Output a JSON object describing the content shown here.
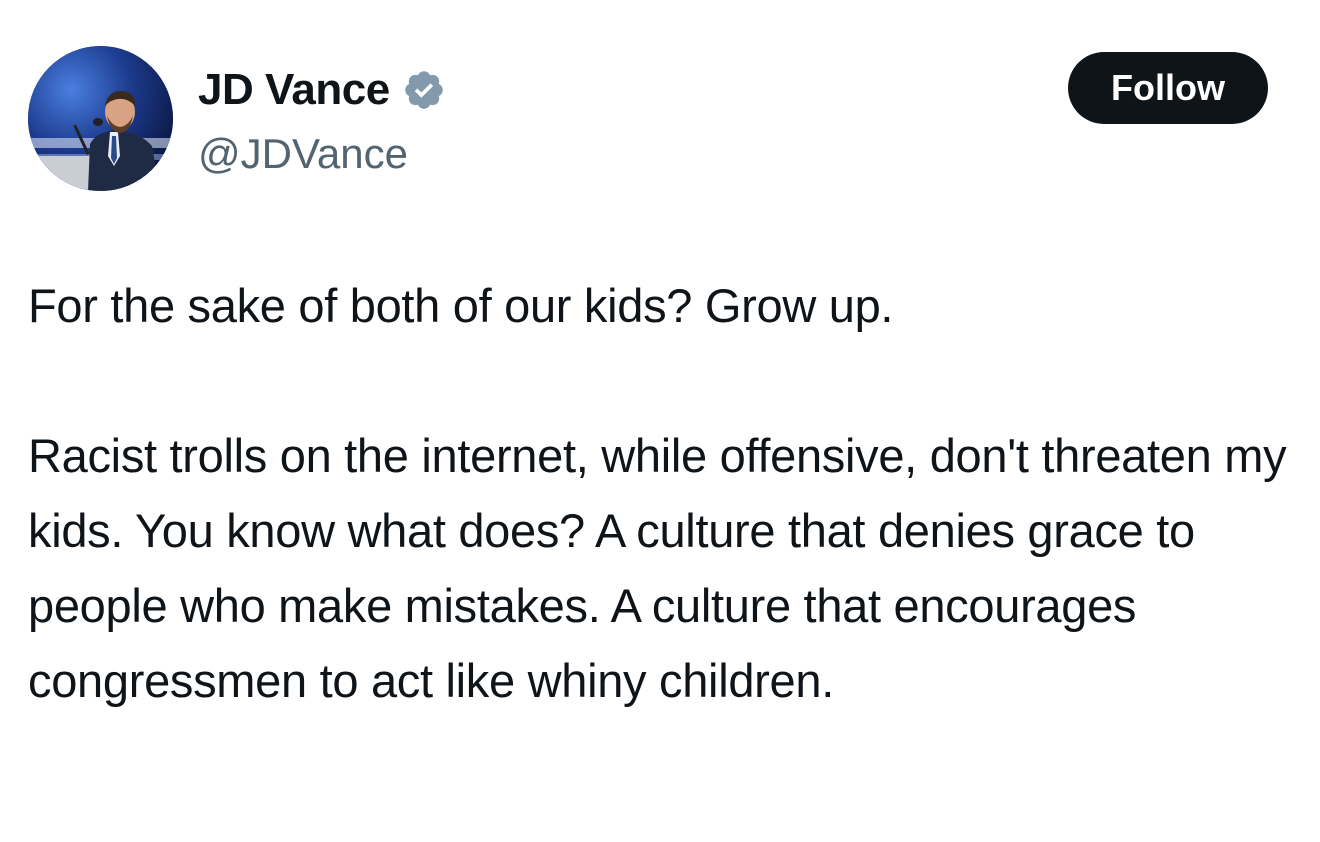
{
  "author": {
    "display_name": "JD Vance",
    "handle": "@JDVance",
    "verified": true,
    "verified_icon": "verified-badge-icon",
    "verified_color": "#829aab"
  },
  "actions": {
    "follow_label": "Follow"
  },
  "tweet": {
    "paragraphs": [
      "For the sake of both of our kids? Grow up.",
      "Racist trolls on the internet, while offensive, don't threaten my kids. You know what does? A culture that denies grace to people who make mistakes. A culture that encourages congressmen to act like whiny children."
    ]
  },
  "colors": {
    "text": "#0f1419",
    "secondary_text": "#536471",
    "button_bg": "#0f1419",
    "button_text": "#ffffff"
  }
}
